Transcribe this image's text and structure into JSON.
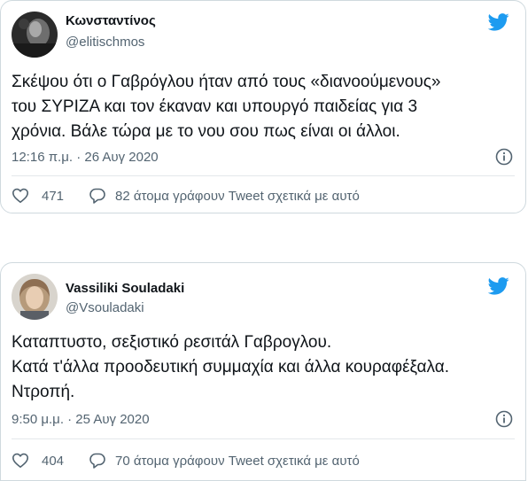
{
  "tweets": [
    {
      "author_name": "Κωνσταντίνος",
      "handle": "@elitischmos",
      "text_lines": [
        "Σκέψου ότι ο Γαβρόγλου ήταν από τους «διανοούμενους»",
        "του ΣΥΡΙΖΑ και τον έκαναν και υπουργό παιδείας για 3",
        "χρόνια. Βάλε τώρα με το νου σου πως είναι οι άλλοι."
      ],
      "timestamp": "12:16 π.μ. · 26 Αυγ 2020",
      "likes": "471",
      "replies_label": "82 άτομα γράφουν Tweet σχετικά με αυτό"
    },
    {
      "author_name": "Vassiliki Souladaki",
      "handle": "@Vsouladaki",
      "text_lines": [
        "Καταπτυστο, σεξιστικό ρεσιτάλ Γαβρογλου.",
        "Κατά τ'άλλα προοδευτική συμμαχία και άλλα κουραφέξαλα.",
        "Ντροπή."
      ],
      "timestamp": "9:50 μ.μ. · 25 Αυγ 2020",
      "likes": "404",
      "replies_label": "70 άτομα γράφουν Tweet σχετικά με αυτό"
    }
  ],
  "colors": {
    "twitter_blue": "#1d9bf0",
    "secondary_text": "#536471",
    "border": "#cfd9de"
  },
  "icons": [
    "twitter-bird-icon",
    "info-icon",
    "heart-icon",
    "reply-bubble-icon"
  ]
}
